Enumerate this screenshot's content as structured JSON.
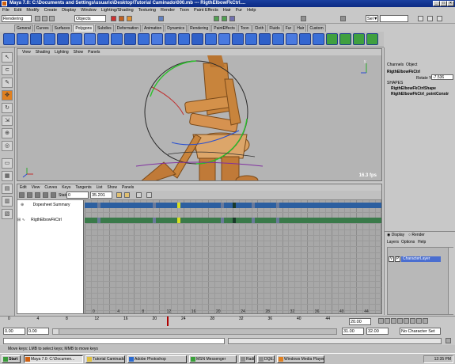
{
  "window": {
    "title": "Maya 7.0: C:\\Documents and Settings\\usuario\\Desktop\\Tutorial Caminado\\000.mb  ---  RigthElbowFkCtrl...."
  },
  "menubar": [
    "File",
    "Edit",
    "Modify",
    "Create",
    "Display",
    "Window",
    "Lighting/Shading",
    "Texturing",
    "Render",
    "Toon",
    "Paint Effects",
    "Hair",
    "Fur",
    "Help"
  ],
  "status": {
    "mode": "Rendering",
    "selmode": "Objects",
    "sel_label": "Sel▼"
  },
  "shelf_tabs": [
    "General",
    "Curves",
    "Surfaces",
    "Polygons",
    "Subdivs",
    "Deformation",
    "Animation",
    "Dynamics",
    "Rendering",
    "PaintEffects",
    "Toon",
    "Cloth",
    "Fluids",
    "Fur",
    "Hair",
    "Custom"
  ],
  "shelf_selected": "Polygons",
  "viewport": {
    "menu": [
      "View",
      "Shading",
      "Lighting",
      "Show",
      "Panels"
    ],
    "fps": "16.3 fps"
  },
  "dopesheet": {
    "menu": [
      "Edit",
      "View",
      "Curves",
      "Keys",
      "Tangents",
      "List",
      "Show",
      "Panels"
    ],
    "stats_label": "Stats",
    "stat1": "0",
    "stat2": "35.201",
    "rows": [
      "Dopesheet Summary",
      "RigthElbowFkCtrl"
    ],
    "ticks": [
      "0",
      "4",
      "8",
      "12",
      "16",
      "20",
      "24",
      "28",
      "32",
      "36",
      "40",
      "44"
    ]
  },
  "channelbox": {
    "tabs": [
      "Channels",
      "Object"
    ],
    "object": "RigthElbowFkCtrl",
    "attr_label": "Rotate Y",
    "attr_value": "-7.536",
    "shapes_label": "SHAPES",
    "shape1": "RigthElbowFkCtrlShape",
    "shape2": "RigthElbowFkCtrl_pointConstr",
    "layer_tabs": [
      "Display",
      "Render"
    ],
    "layer_menu": [
      "Layers",
      "Options",
      "Help"
    ],
    "layer_name": "CharacterLayer",
    "layer_v": "V",
    "layer_p": "P"
  },
  "timeslider": {
    "ticks": [
      "0",
      "4",
      "8",
      "12",
      "16",
      "20",
      "24",
      "28",
      "32",
      "36",
      "40",
      "44"
    ],
    "current": "20.00"
  },
  "range": {
    "start": "0.00",
    "start2": "0.00",
    "end1": "31.00",
    "end2": "32.00",
    "charset": "No Character Set"
  },
  "helpline": "Move keys: LMB to select keys; MMB to move keys",
  "taskbar": {
    "start": "Start",
    "items": [
      "Maya 7.0: C:\\Documen...",
      "Tutorial Caminado",
      "Adobe Photoshop",
      "MSN Messenger",
      "Radio",
      "DQE...",
      "Windows Media Player"
    ],
    "clock": "12:35 PM"
  },
  "colors": {
    "accent": "#0b2a84",
    "key": "#d8e020",
    "ds_summary": "#2c5fa0",
    "ds_ctrl": "#3a7a4a",
    "timeslider_cursor": "#b00000"
  }
}
